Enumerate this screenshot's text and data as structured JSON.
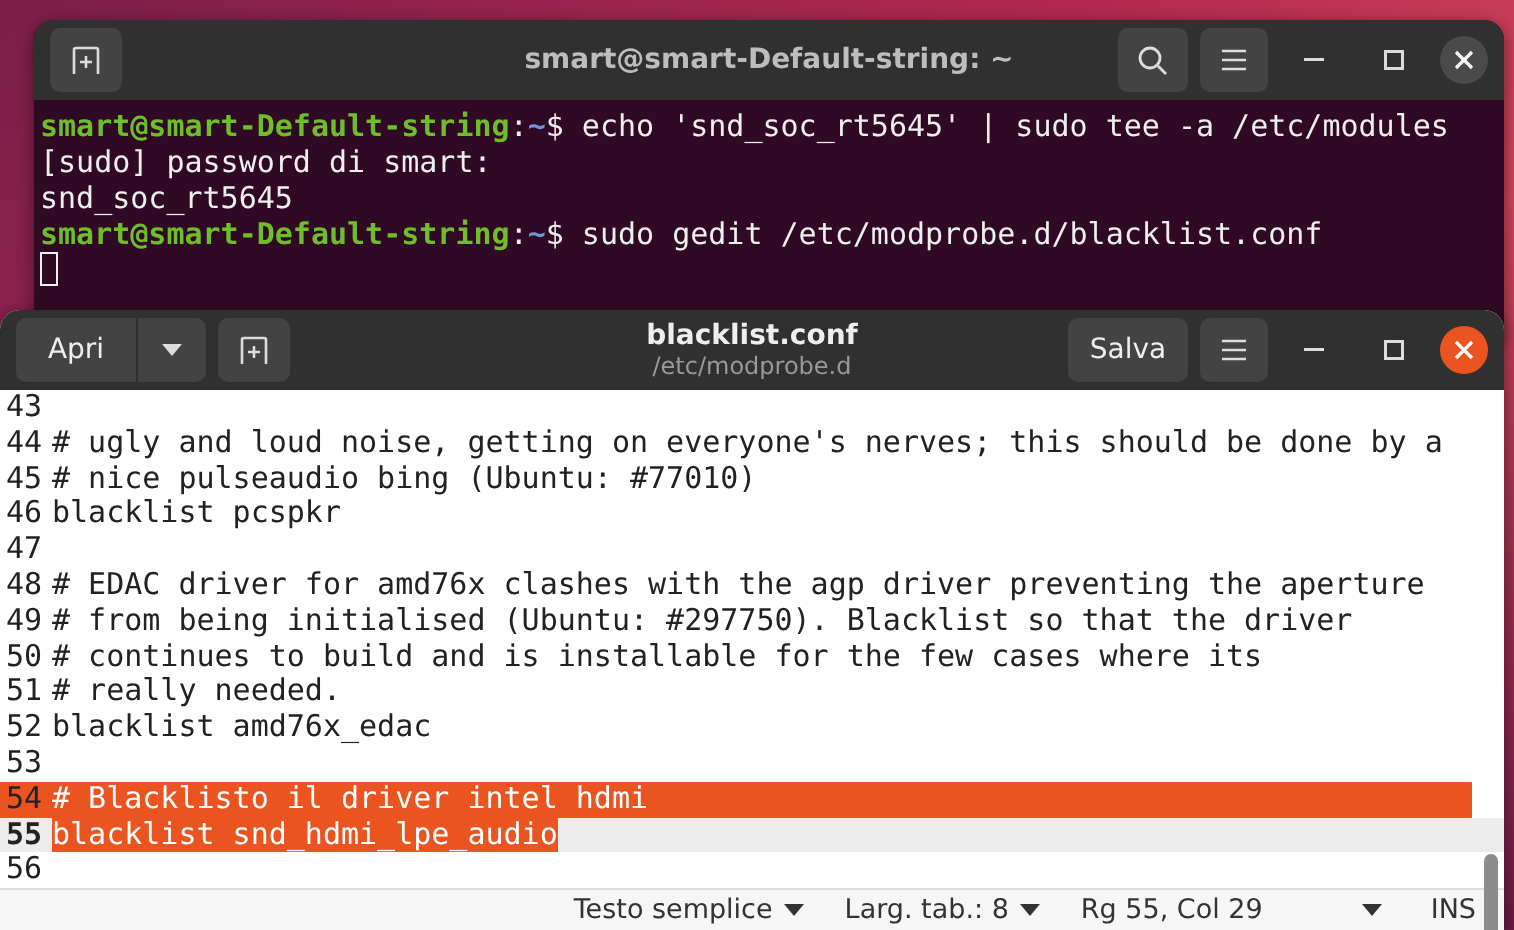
{
  "terminal": {
    "title": "smart@smart-Default-string: ~",
    "lines": [
      {
        "segments": [
          {
            "kind": "user",
            "text": "smart@smart-Default-string"
          },
          {
            "kind": "plain",
            "text": ":"
          },
          {
            "kind": "path",
            "text": "~"
          },
          {
            "kind": "plain",
            "text": "$ echo 'snd_soc_rt5645' | sudo tee -a /etc/modules"
          }
        ]
      },
      {
        "segments": [
          {
            "kind": "plain",
            "text": "[sudo] password di smart:"
          }
        ]
      },
      {
        "segments": [
          {
            "kind": "plain",
            "text": "snd_soc_rt5645"
          }
        ]
      },
      {
        "segments": [
          {
            "kind": "user",
            "text": "smart@smart-Default-string"
          },
          {
            "kind": "plain",
            "text": ":"
          },
          {
            "kind": "path",
            "text": "~"
          },
          {
            "kind": "plain",
            "text": "$ sudo gedit /etc/modprobe.d/blacklist.conf"
          }
        ]
      }
    ]
  },
  "editor": {
    "title": "blacklist.conf",
    "subtitle": "/etc/modprobe.d",
    "open_button": "Apri",
    "save_button": "Salva",
    "lines": [
      {
        "number": "43",
        "selected": false,
        "current": false
      },
      {
        "number": "44",
        "text": "# ugly and loud noise, getting on everyone's nerves; this should be done by a",
        "selected": false,
        "current": false
      },
      {
        "number": "45",
        "text": "# nice pulseaudio bing (Ubuntu: #77010)",
        "selected": false,
        "current": false
      },
      {
        "number": "46",
        "text": "blacklist pcspkr",
        "selected": false,
        "current": false
      },
      {
        "number": "47",
        "selected": false,
        "current": false
      },
      {
        "number": "48",
        "text": "# EDAC driver for amd76x clashes with the agp driver preventing the aperture",
        "selected": false,
        "current": false
      },
      {
        "number": "49",
        "text": "# from being initialised (Ubuntu: #297750). Blacklist so that the driver",
        "selected": false,
        "current": false
      },
      {
        "number": "50",
        "text": "# continues to build and is installable for the few cases where its",
        "selected": false,
        "current": false
      },
      {
        "number": "51",
        "text": "# really needed.",
        "selected": false,
        "current": false
      },
      {
        "number": "52",
        "text": "blacklist amd76x_edac",
        "selected": false,
        "current": false
      },
      {
        "number": "53",
        "selected": false,
        "current": false
      },
      {
        "number": "54",
        "text": "# Blacklisto il driver intel hdmi",
        "selected": true,
        "current": false
      },
      {
        "number": "55",
        "text": "blacklist snd_hdmi_lpe_audio",
        "selected": true,
        "current": true
      },
      {
        "number": "56",
        "selected": false,
        "current": false
      }
    ],
    "status_bar": {
      "language": "Testo semplice",
      "tab_width": "Larg. tab.: 8",
      "position": "Rg 55, Col 29",
      "mode": "INS"
    }
  }
}
